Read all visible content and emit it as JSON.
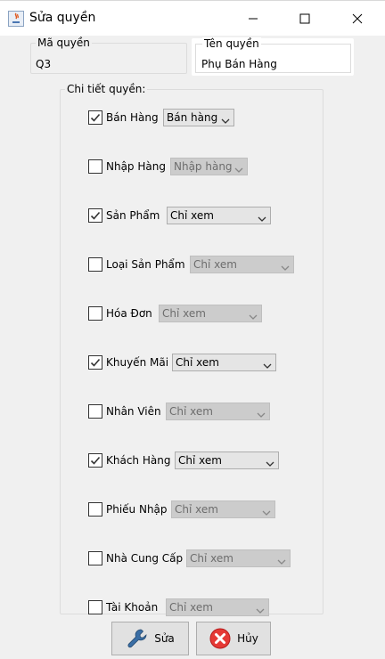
{
  "window": {
    "title": "Sửa quyền"
  },
  "role_id": {
    "label": "Mã quyền",
    "value": "Q3"
  },
  "role_name": {
    "label": "Tên quyền",
    "value": "Phụ Bán Hàng"
  },
  "details": {
    "label": "Chi tiết quyền:",
    "permissions": [
      {
        "name": "Bán Hàng",
        "checked": true,
        "selected": "Bán hàng",
        "enabled": true
      },
      {
        "name": "Nhập Hàng",
        "checked": false,
        "selected": "Nhập hàng",
        "enabled": false
      },
      {
        "name": "Sản Phẩm",
        "checked": true,
        "selected": "Chỉ xem",
        "enabled": true
      },
      {
        "name": "Loại Sản Phẩm",
        "checked": false,
        "selected": "Chỉ xem",
        "enabled": false
      },
      {
        "name": "Hóa Đơn",
        "checked": false,
        "selected": "Chỉ xem",
        "enabled": false
      },
      {
        "name": "Khuyến Mãi",
        "checked": true,
        "selected": "Chỉ xem",
        "enabled": true
      },
      {
        "name": "Nhân Viên",
        "checked": false,
        "selected": "Chỉ xem",
        "enabled": false
      },
      {
        "name": "Khách Hàng",
        "checked": true,
        "selected": "Chỉ xem",
        "enabled": true
      },
      {
        "name": "Phiếu Nhập",
        "checked": false,
        "selected": "Chỉ xem",
        "enabled": false
      },
      {
        "name": "Nhà Cung Cấp",
        "checked": false,
        "selected": "Chỉ xem",
        "enabled": false
      },
      {
        "name": "Tài Khoản",
        "checked": false,
        "selected": "Chỉ xem",
        "enabled": false
      }
    ]
  },
  "buttons": {
    "save": {
      "label": "Sửa",
      "icon": "wrench-icon"
    },
    "cancel": {
      "label": "Hủy",
      "icon": "close-circle-icon"
    }
  },
  "colors": {
    "cancel_icon": "#e53935",
    "save_icon": "#3a6ea5"
  }
}
